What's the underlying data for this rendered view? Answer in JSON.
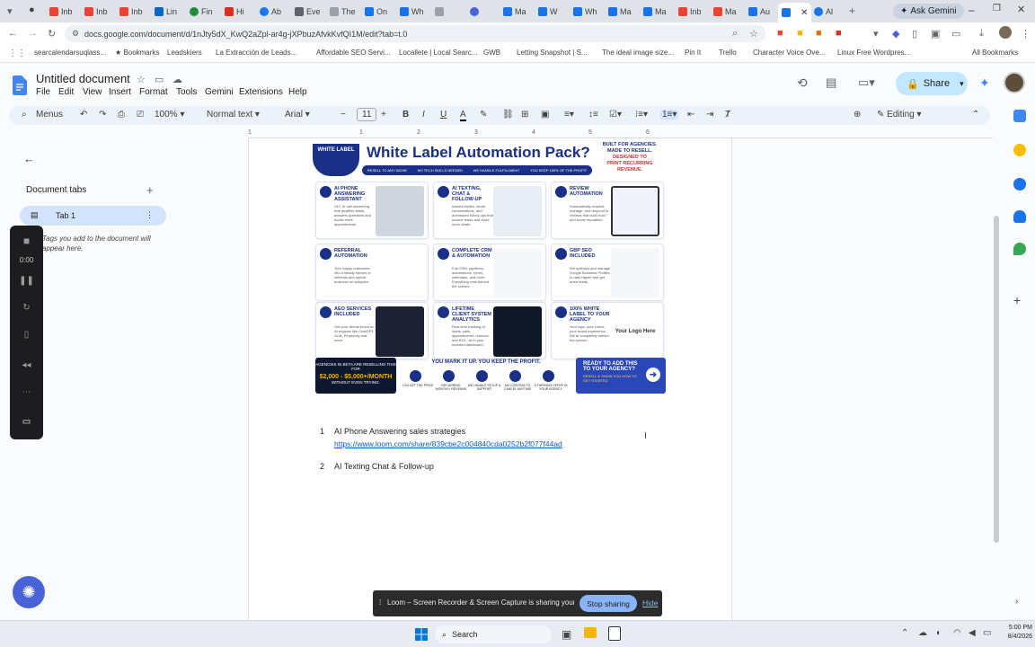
{
  "browser": {
    "tabs": [
      "Inb",
      "Inb",
      "Inb",
      "Lin",
      "Fin",
      "Hi",
      "Ab",
      "Eve",
      "The",
      "On",
      "Wh",
      "",
      "",
      "Ma",
      "W",
      "Wh",
      "Ma",
      "Ma",
      "Inb",
      "Ma",
      "Au",
      "",
      "Al"
    ],
    "ask_gemini": "Ask Gemini",
    "url": "docs.google.com/document/d/1nJty5dX_KwQ2aZpl-ar4g-jXPbuzAfvkKvfQI1M/edit?tab=t.0",
    "bookmarks": [
      "searcalendarsuqlass...",
      "Bookmarks",
      "Leadskiers",
      "La Extracción de Leads...",
      "Affordable SEO Servi...",
      "Locallete | Local Searc...",
      "GWB",
      "Letting Snapshot | S...",
      "The ideal image size...",
      "Pin It",
      "Trello",
      "Character Voice Ove...",
      "Linux Free Wordpres..."
    ],
    "all_bookmarks": "All Bookmarks"
  },
  "docs": {
    "title": "Untitled document",
    "menus": [
      "File",
      "Edit",
      "View",
      "Insert",
      "Format",
      "Tools",
      "Gemini",
      "Extensions",
      "Help"
    ],
    "share_label": "Share",
    "toolbar": {
      "menus_label": "Menus",
      "zoom": "100%",
      "style": "Normal text",
      "font": "Arial",
      "font_size": "11",
      "mode": "Editing"
    },
    "left_panel": {
      "tabs_heading": "Document tabs",
      "tab1": "Tab 1",
      "hint": "Tags you add to the document will appear here."
    },
    "recorder_time": "0:00",
    "ruler_numbers": [
      "1",
      "1",
      "2",
      "3",
      "4",
      "5",
      "6"
    ]
  },
  "infographic": {
    "badge": "WHITE LABEL",
    "title": "White Label Automation Pack?",
    "side_line1": "BUILT FOR AGENCIES.",
    "side_line2": "MADE TO RESELL.",
    "side_line3": "DESIGNED TO",
    "side_line4": "PRINT RECURRING",
    "side_line5": "REVENUE.",
    "pills": [
      "RESELL TO ANY NICHE",
      "NO TECH SKILLS NEEDED",
      "WE HANDLE FULFILLMENT",
      "YOU KEEP 100% OF THE PROFIT"
    ],
    "cards": [
      {
        "title": "AI PHONE ANSWERING ASSISTANT",
        "desc": "24/7 AI call answering that qualifies leads, answers questions and books more appointments."
      },
      {
        "title": "AI TEXTING, CHAT & FOLLOW-UP",
        "desc": "Instant replies, smart conversations, and automated follow-ups that nurture leads and close more deals."
      },
      {
        "title": "REVIEW AUTOMATION",
        "desc": "Automatically request, manage, and respond to reviews that build trust and boost reputation."
      },
      {
        "title": "REFERRAL AUTOMATION",
        "desc": "Turn happy customers into a steady stream of referrals and repeat business on autopilot."
      },
      {
        "title": "COMPLETE CRM & AUTOMATION",
        "desc": "Full CRM, pipelines, automations, forms, calendars, and more. Everything runs behind the scenes."
      },
      {
        "title": "GBP SEO INCLUDED",
        "desc": "We optimize and manage Google Business Profiles to rank higher and get more leads."
      },
      {
        "title": "AEO SERVICES INCLUDED",
        "desc": "Get your clients found on AI engines like ChatGPT, Grok, Perplexity and more."
      },
      {
        "title": "LIFETIME CLIENT SYSTEM ANALYTICS",
        "desc": "Real-time tracking of leads, calls, appointments, revenue and ROI - all in your branded dashboard."
      },
      {
        "title": "100% WHITE LABEL TO YOUR AGENCY",
        "desc": "Your logo, your colors, your brand experience. We're completely behind the scenes."
      }
    ],
    "logo_here": "Your Logo Here",
    "foot_left": "AGENCIES IN BETA ARE RESELLING THIS FOR",
    "foot_left_price": "$2,000 - $5,000+/MONTH",
    "foot_left_sub": "WITHOUT EVEN TRYING.",
    "foot_mid": "YOU MARK IT UP. YOU KEEP THE PROFIT.",
    "foot_icons": [
      "YOU SET THE PRICE",
      "RECURRING MONTHLY REVENUE",
      "WE HANDLE SETUP & SUPPORT",
      "NO CONTRACTS CANCEL ANYTIME",
      "A THRIVING OFFER IN YOUR AGENCY"
    ],
    "foot_right": "READY TO ADD THIS TO YOUR AGENCY?",
    "foot_right_sub": "RESELL & SHOW YOU HOW TO GET STARTED"
  },
  "list": [
    {
      "num": "1",
      "text": "AI Phone Answering sales strategies",
      "link": "https://www.loom.com/share/839cbe2c004840cda0252b2f077f44ad"
    },
    {
      "num": "2",
      "text": "AI Texting Chat & Follow-up"
    }
  ],
  "sharing_bar": {
    "message": "Loom – Screen Recorder & Screen Capture is sharing your screen.",
    "stop": "Stop sharing",
    "hide": "Hide"
  },
  "taskbar": {
    "search": "Search",
    "time": "5:00 PM",
    "date": "8/4/2026"
  }
}
